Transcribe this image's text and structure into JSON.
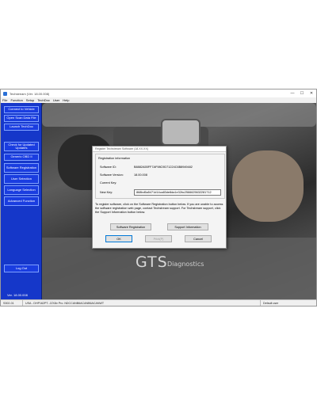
{
  "window": {
    "title": "Techstream (Ver. 18.00.008)",
    "controls": [
      "—",
      "☐",
      "✕"
    ]
  },
  "menu": [
    "File",
    "Function",
    "Setup",
    "TechDoc",
    "User",
    "Help"
  ],
  "sidebar": {
    "items": [
      {
        "label": "Connect to Vehicle"
      },
      {
        "label": "Open Scan Data File"
      },
      {
        "label": "Launch TechDoc"
      },
      {
        "label": "Check for Updated Updates"
      },
      {
        "label": "Generic OBD II"
      },
      {
        "label": "Software Registration"
      },
      {
        "label": "User Selection"
      },
      {
        "label": "Language Selection"
      },
      {
        "label": "Advanced Function"
      },
      {
        "label": "Log Out"
      }
    ],
    "version": "Ver. 18.00.008"
  },
  "brand": {
    "name": "GTS",
    "sub": "Diagnostics"
  },
  "dialog": {
    "title": "Register Techstream Software (18.XX.XX)",
    "group_label": "Registration information",
    "software_id_label": "Software ID:",
    "software_id": "B8882A55FF7AF98C9D71224C6B8949482",
    "software_version_label": "Software Version:",
    "software_version": "18.00.008",
    "current_key_label": "Current Key:",
    "current_key": "",
    "new_key_label": "New Key:",
    "new_key": "868bd5a5471d14ca83de8da1e32bc2566625632281712",
    "instructions": "To register software, click on the Software Registration button below. If you are unable to access the software registration web page, contact Techstream support. For Techstream support, click the Support Information button below.",
    "buttons": {
      "software_registration": "Software Registration",
      "support_information": "Support Information",
      "ok": "OK",
      "print": "Print(P)",
      "cancel": "Cancel"
    }
  },
  "status_bar": {
    "code": "S302-01",
    "vehicle": "USA - DHP162PT- JZX8v Pro. NDCCANB6ACANB6ACANWT",
    "user": "Default user"
  },
  "colors": {
    "sidebar": "#1537c9",
    "sidebar_button": "#1a3de0",
    "dialog_bg": "#f4f4f4"
  }
}
